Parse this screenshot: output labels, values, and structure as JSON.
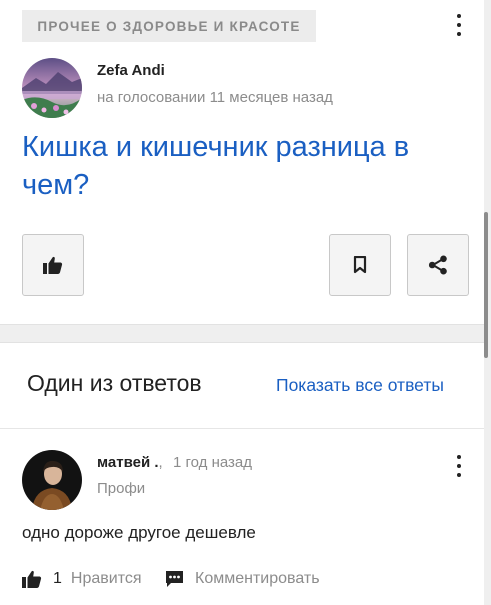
{
  "question": {
    "category": "ПРОЧЕЕ О ЗДОРОВЬЕ И КРАСОТЕ",
    "author": "Zefa Andi",
    "meta": "на голосовании 11 месяцев назад",
    "title": "Кишка и кишечник разница в чем?",
    "icons": {
      "menu": "more-vertical-icon",
      "like": "thumbs-up-icon",
      "bookmark": "bookmark-icon",
      "share": "share-icon"
    }
  },
  "answers": {
    "heading": "Один из ответов",
    "show_all": "Показать все ответы",
    "items": [
      {
        "author": "матвей .",
        "separator": ",",
        "time": "1 год назад",
        "rank": "Профи",
        "text": "одно дороже другое дешевле",
        "likes_count": "1",
        "like_label": "Нравится",
        "comment_label": "Комментировать"
      }
    ]
  },
  "colors": {
    "link": "#1a5fc2",
    "muted": "#8c8c8c",
    "background": "#efefef"
  }
}
